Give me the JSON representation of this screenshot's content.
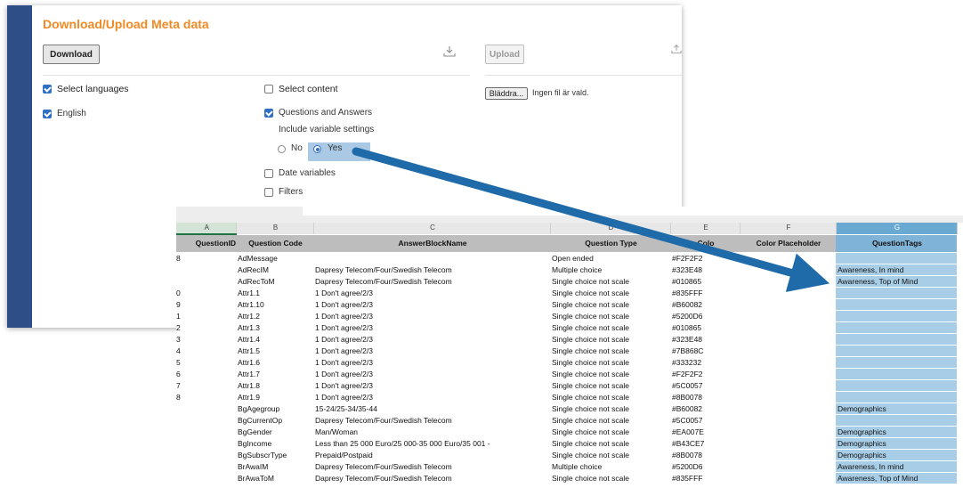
{
  "dialog": {
    "title": "Download/Upload Meta data",
    "download_label": "Download",
    "upload_label": "Upload",
    "select_languages": "Select languages",
    "language_english": "English",
    "select_content": "Select content",
    "questions_answers": "Questions and Answers",
    "include_variable_settings": "Include variable settings",
    "radio_no": "No",
    "radio_yes": "Yes",
    "date_variables": "Date variables",
    "filters": "Filters",
    "browse_label": "Bläddra...",
    "no_file": "Ingen fil är vald."
  },
  "sheet": {
    "columns": [
      "A",
      "B",
      "C",
      "D",
      "E",
      "F",
      "G"
    ],
    "headers": [
      "QuestionID",
      "Question Code",
      "AnswerBlockName",
      "Question Type",
      "Colo",
      "Color Placeholder",
      "QuestionTags"
    ],
    "rows": [
      [
        "8",
        "AdMessage",
        "",
        "Open ended",
        "#F2F2F2",
        "",
        ""
      ],
      [
        "",
        "AdRecIM",
        "Dapresy Telecom/Four/Swedish Telecom",
        "Multiple choice",
        "#323E48",
        "",
        "Awareness, In mind"
      ],
      [
        "",
        "AdRecToM",
        "Dapresy Telecom/Four/Swedish Telecom",
        "Single choice not scale",
        "#010865",
        "",
        "Awareness, Top of Mind"
      ],
      [
        "0",
        "Attr1.1",
        "1 Don't agree/2/3",
        "Single choice not scale",
        "#835FFF",
        "",
        ""
      ],
      [
        "9",
        "Attr1.10",
        "1 Don't agree/2/3",
        "Single choice not scale",
        "#B60082",
        "",
        ""
      ],
      [
        "1",
        "Attr1.2",
        "1 Don't agree/2/3",
        "Single choice not scale",
        "#5200D6",
        "",
        ""
      ],
      [
        "2",
        "Attr1.3",
        "1 Don't agree/2/3",
        "Single choice not scale",
        "#010865",
        "",
        ""
      ],
      [
        "3",
        "Attr1.4",
        "1 Don't agree/2/3",
        "Single choice not scale",
        "#323E48",
        "",
        ""
      ],
      [
        "4",
        "Attr1.5",
        "1 Don't agree/2/3",
        "Single choice not scale",
        "#7B868C",
        "",
        ""
      ],
      [
        "5",
        "Attr1.6",
        "1 Don't agree/2/3",
        "Single choice not scale",
        "#333232",
        "",
        ""
      ],
      [
        "6",
        "Attr1.7",
        "1 Don't agree/2/3",
        "Single choice not scale",
        "#F2F2F2",
        "",
        ""
      ],
      [
        "7",
        "Attr1.8",
        "1 Don't agree/2/3",
        "Single choice not scale",
        "#5C0057",
        "",
        ""
      ],
      [
        "8",
        "Attr1.9",
        "1 Don't agree/2/3",
        "Single choice not scale",
        "#8B0078",
        "",
        ""
      ],
      [
        "",
        "BgAgegroup",
        "15-24/25-34/35-44",
        "Single choice not scale",
        "#B60082",
        "",
        "Demographics"
      ],
      [
        "",
        "BgCurrentOp",
        "Dapresy Telecom/Four/Swedish Telecom",
        "Single choice not scale",
        "#5C0057",
        "",
        ""
      ],
      [
        "",
        "BgGender",
        "Man/Woman",
        "Single choice not scale",
        "#EA007E",
        "",
        "Demographics"
      ],
      [
        "",
        "BgIncome",
        "Less than 25 000 Euro/25 000-35 000 Euro/35 001 -",
        "Single choice not scale",
        "#B43CE7",
        "",
        "Demographics"
      ],
      [
        "",
        "BgSubscrType",
        "Prepaid/Postpaid",
        "Single choice not scale",
        "#8B0078",
        "",
        "Demographics"
      ],
      [
        "",
        "BrAwaIM",
        "Dapresy Telecom/Four/Swedish Telecom",
        "Multiple choice",
        "#5200D6",
        "",
        "Awareness, In mind"
      ],
      [
        "",
        "BrAwaToM",
        "Dapresy Telecom/Four/Swedish Telecom",
        "Single choice not scale",
        "#835FFF",
        "",
        "Awareness, Top of Mind"
      ]
    ]
  },
  "colors": {
    "title_orange": "#f08a24",
    "dialog_bar": "#2d4e86",
    "checkbox_blue": "#2f6fc4",
    "tag_column": "#a8cde6",
    "arrow": "#1f6aa8"
  },
  "icons": [
    "download-icon",
    "upload-icon",
    "checkbox-checked-icon",
    "radio-selected-icon"
  ]
}
